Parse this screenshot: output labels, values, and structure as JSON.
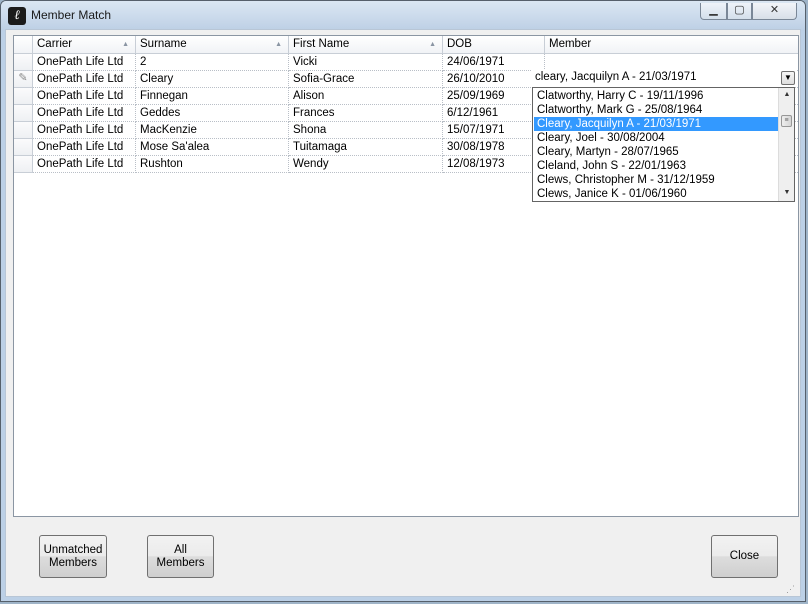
{
  "window": {
    "title": "Member Match"
  },
  "grid": {
    "columns": [
      "Carrier",
      "Surname",
      "First Name",
      "DOB",
      "Member"
    ],
    "rows": [
      {
        "carrier": "OnePath Life Ltd",
        "surname": "2",
        "first": "Vicki",
        "dob": "24/06/1971",
        "member": ""
      },
      {
        "carrier": "OnePath Life Ltd",
        "surname": "Cleary",
        "first": "Sofia-Grace",
        "dob": "26/10/2010",
        "member": "cleary, Jacquilyn A - 21/03/1971"
      },
      {
        "carrier": "OnePath Life Ltd",
        "surname": "Finnegan",
        "first": "Alison",
        "dob": "25/09/1969",
        "member": ""
      },
      {
        "carrier": "OnePath Life Ltd",
        "surname": "Geddes",
        "first": "Frances",
        "dob": "6/12/1961",
        "member": ""
      },
      {
        "carrier": "OnePath Life Ltd",
        "surname": "MacKenzie",
        "first": "Shona",
        "dob": "15/07/1971",
        "member": ""
      },
      {
        "carrier": "OnePath Life Ltd",
        "surname": "Mose Sa'alea",
        "first": "Tuitamaga",
        "dob": "30/08/1978",
        "member": ""
      },
      {
        "carrier": "OnePath Life Ltd",
        "surname": "Rushton",
        "first": "Wendy",
        "dob": "12/08/1973",
        "member": ""
      }
    ],
    "editing_row_marker": "✎"
  },
  "dropdown": {
    "options": [
      "Clatworthy, Harry C - 19/11/1996",
      "Clatworthy, Mark G - 25/08/1964",
      "Cleary, Jacquilyn A - 21/03/1971",
      "Cleary, Joel - 30/08/2004",
      "Cleary, Martyn - 28/07/1965",
      "Cleland, John S - 22/01/1963",
      "Clews, Christopher M - 31/12/1959",
      "Clews, Janice K - 01/06/1960"
    ],
    "selected_index": 2
  },
  "buttons": {
    "unmatched": "Unmatched\nMembers",
    "all": "All\nMembers",
    "close": "Close"
  },
  "icons": {
    "app": "app-logo-icon",
    "minimize": "minimize-icon",
    "maximize": "maximize-icon",
    "close": "close-icon",
    "pencil": "pencil-icon",
    "sort": "sort-arrow-icon",
    "dropdown": "chevron-down-icon"
  },
  "colors": {
    "selection": "#3399ff",
    "titlebar": "#bccfe5"
  }
}
